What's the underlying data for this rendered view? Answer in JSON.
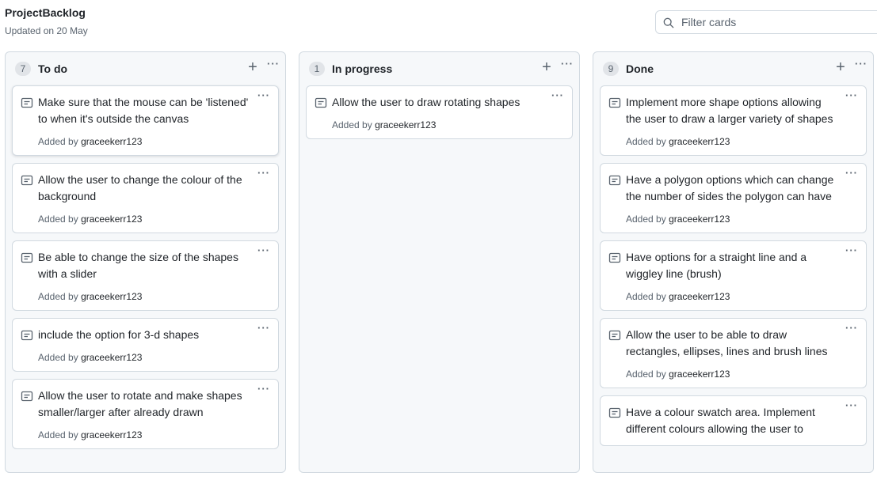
{
  "project": {
    "title": "ProjectBacklog",
    "updated": "Updated on 20 May"
  },
  "filter": {
    "placeholder": "Filter cards",
    "value": ""
  },
  "icons": {
    "search": "search-icon",
    "note": "note-icon",
    "add": "plus-icon",
    "more": "kebab-horizontal-icon"
  },
  "columns": [
    {
      "count": "7",
      "name": "To do",
      "cards": [
        {
          "title": "Make sure that the mouse can be 'listened' to when it's outside the canvas",
          "added_prefix": "Added by",
          "user": "graceekerr123"
        },
        {
          "title": "Allow the user to change the colour of the background",
          "added_prefix": "Added by",
          "user": "graceekerr123"
        },
        {
          "title": "Be able to change the size of the shapes with a slider",
          "added_prefix": "Added by",
          "user": "graceekerr123"
        },
        {
          "title": "include the option for 3-d shapes",
          "added_prefix": "Added by",
          "user": "graceekerr123"
        },
        {
          "title": "Allow the user to rotate and make shapes smaller/larger after already drawn",
          "added_prefix": "Added by",
          "user": "graceekerr123"
        }
      ]
    },
    {
      "count": "1",
      "name": "In progress",
      "cards": [
        {
          "title": "Allow the user to draw rotating shapes",
          "added_prefix": "Added by",
          "user": "graceekerr123"
        }
      ]
    },
    {
      "count": "9",
      "name": "Done",
      "cards": [
        {
          "title": "Implement more shape options allowing the user to draw a larger variety of shapes",
          "added_prefix": "Added by",
          "user": "graceekerr123"
        },
        {
          "title": "Have a polygon options which can change the number of sides the polygon can have",
          "added_prefix": "Added by",
          "user": "graceekerr123"
        },
        {
          "title": "Have options for a straight line and a wiggley line (brush)",
          "added_prefix": "Added by",
          "user": "graceekerr123"
        },
        {
          "title": "Allow the user to be able to draw rectangles, ellipses, lines and brush lines",
          "added_prefix": "Added by",
          "user": "graceekerr123"
        },
        {
          "title": "Have a colour swatch area. Implement different colours allowing the user to",
          "added_prefix": "",
          "user": ""
        }
      ]
    }
  ]
}
